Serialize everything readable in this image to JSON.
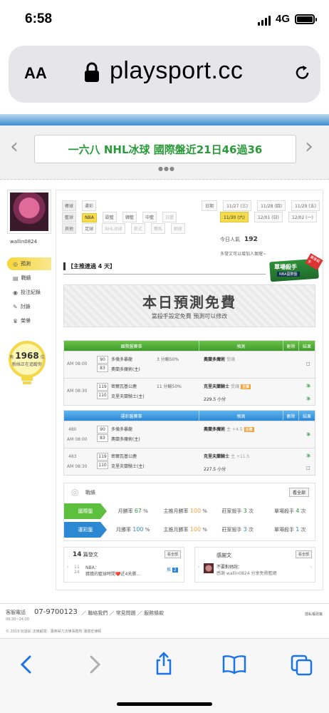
{
  "status": {
    "time": "6:58",
    "network": "4G"
  },
  "browser": {
    "text_size": "AA",
    "url": "playsport.cc"
  },
  "banner": {
    "text": "一六八 NHL冰球 國際盤近21日46過36"
  },
  "sidebar": {
    "username": "wallin0824",
    "items": [
      {
        "label": "預測",
        "icon": "target-icon"
      },
      {
        "label": "戰績",
        "icon": "chart-icon"
      },
      {
        "label": "投注紀錄",
        "icon": "record-icon"
      },
      {
        "label": "討論",
        "icon": "pencil-icon"
      },
      {
        "label": "榮譽",
        "icon": "trophy-icon"
      }
    ],
    "bulb_prefix": "有",
    "bulb_count": "1968",
    "bulb_suffix": "位",
    "bulb_text": "粉絲正在追蹤你"
  },
  "filters": {
    "row1_label": "棒球",
    "row1": [
      "運彩"
    ],
    "row2_label": "籃球",
    "row2": [
      "NBA",
      "歐籃",
      "韓籃",
      "中籃",
      "日籃"
    ],
    "row3_label": "其他",
    "row3": [
      "足球",
      "NHL冰球",
      "美式",
      "賽馬",
      "網球"
    ],
    "date_label": "日期",
    "dates_row1": [
      "11/27 (三)",
      "11/28 (四)",
      "11/29 (五)"
    ],
    "dates_row2": [
      "11/30 (六)",
      "12/01 (日)",
      "12/02 (一)"
    ]
  },
  "popularity": {
    "label": "今日人氣",
    "value": "192",
    "more": "多發文可以增加人氣喔~"
  },
  "streak": {
    "text": "【主推連過 4 天】"
  },
  "badge": {
    "title": "單場殺手",
    "sub": "NBA國際盤",
    "ribbon": "賽事殺手"
  },
  "free": {
    "title": "本日預測免費",
    "sub": "當殺手設定免費  預測可以修改"
  },
  "intl_table": {
    "headers": [
      "國際盤賽事",
      "預測",
      "刪除",
      "結果"
    ],
    "rows": [
      {
        "time": "AM 08:00",
        "s1": "90",
        "s2": "83",
        "team1": "多倫多暴龍",
        "team2": "奧蘭多魔術(主)",
        "stat": "3 分輸50%",
        "pick": "奧蘭多魔術",
        "pick_tag": "受讓",
        "pick2": "",
        "result": "□"
      },
      {
        "time": "AM 08:30",
        "s1": "119",
        "s2": "110",
        "team1": "密爾瓦基公鹿",
        "team2": "克里夫蘭騎士(主)",
        "stat": "11 分輸50%",
        "pick": "克里夫蘭騎士",
        "pick_tag": "受讓",
        "pick2": "229.5 小分",
        "result": "準"
      }
    ],
    "results_col": [
      "□",
      "準",
      "準"
    ]
  },
  "sport_table": {
    "headers": [
      "運彩盤賽事",
      "預測",
      "刪除",
      "結果"
    ],
    "rows": [
      {
        "num": "480",
        "time": "AM 08:00",
        "s1": "90",
        "s2": "83",
        "team1": "多倫多暴龍",
        "team2": "奧蘭多魔術(主)",
        "pick": "奧蘭多魔術",
        "pick_tag": "主 +4.5",
        "pick2": "",
        "result": "準"
      },
      {
        "num": "483",
        "time": "AM 08:30",
        "s1": "119",
        "s2": "110",
        "team1": "密爾瓦基公鹿",
        "team2": "克里夫蘭騎士(主)",
        "pick": "克里夫蘭騎士",
        "pick_tag": "主 +11.5",
        "pick2": "227.5 小分",
        "result": "準"
      }
    ],
    "results_col": [
      "準",
      "準",
      "□"
    ]
  },
  "results": {
    "title": "戰績",
    "button": "看全部",
    "rows": [
      {
        "label": "國際盤",
        "color": "#5cbf3d",
        "c1": "月勝率",
        "v1": "67",
        "u1": "%",
        "c2": "主推月勝率",
        "v2": "100",
        "u2": "%",
        "c3": "莊家殺手",
        "v3": "3",
        "u3": "次",
        "c4": "單場殺手",
        "v4": "4",
        "u4": "次"
      },
      {
        "label": "運彩盤",
        "color": "#2d88d3",
        "c1": "月勝率",
        "v1": "100",
        "u1": "%",
        "c2": "主推月勝率",
        "v2": "100",
        "u2": "%",
        "c3": "莊家殺手",
        "v3": "3",
        "u3": "次",
        "c4": "單場殺手",
        "v4": "1",
        "u4": "次"
      }
    ]
  },
  "posts": {
    "count": "14",
    "title": "篇發文",
    "button": "看全部",
    "date_top": "11",
    "date_bot": "24",
    "post_title": "NBA：",
    "post_body": "猜猜的籃球時間❤️近4天勝...",
    "post_badge": "2"
  },
  "thanks": {
    "title": "感謝文",
    "button": "看全部",
    "line1": "不要對她說：",
    "line2": "感謝 wallin0824 分享免費籃網"
  },
  "footer": {
    "service_label": "客服電話",
    "hours": "09:30~24:00",
    "phone": "07-9700123",
    "links": [
      "聯絡我們",
      "常見問題",
      "服務條款"
    ],
    "privacy": "隱私權政策",
    "copyright": "© 2019 玩運彩 法律顧問：蒲英得力法律事務所 蒲億宏律師"
  }
}
